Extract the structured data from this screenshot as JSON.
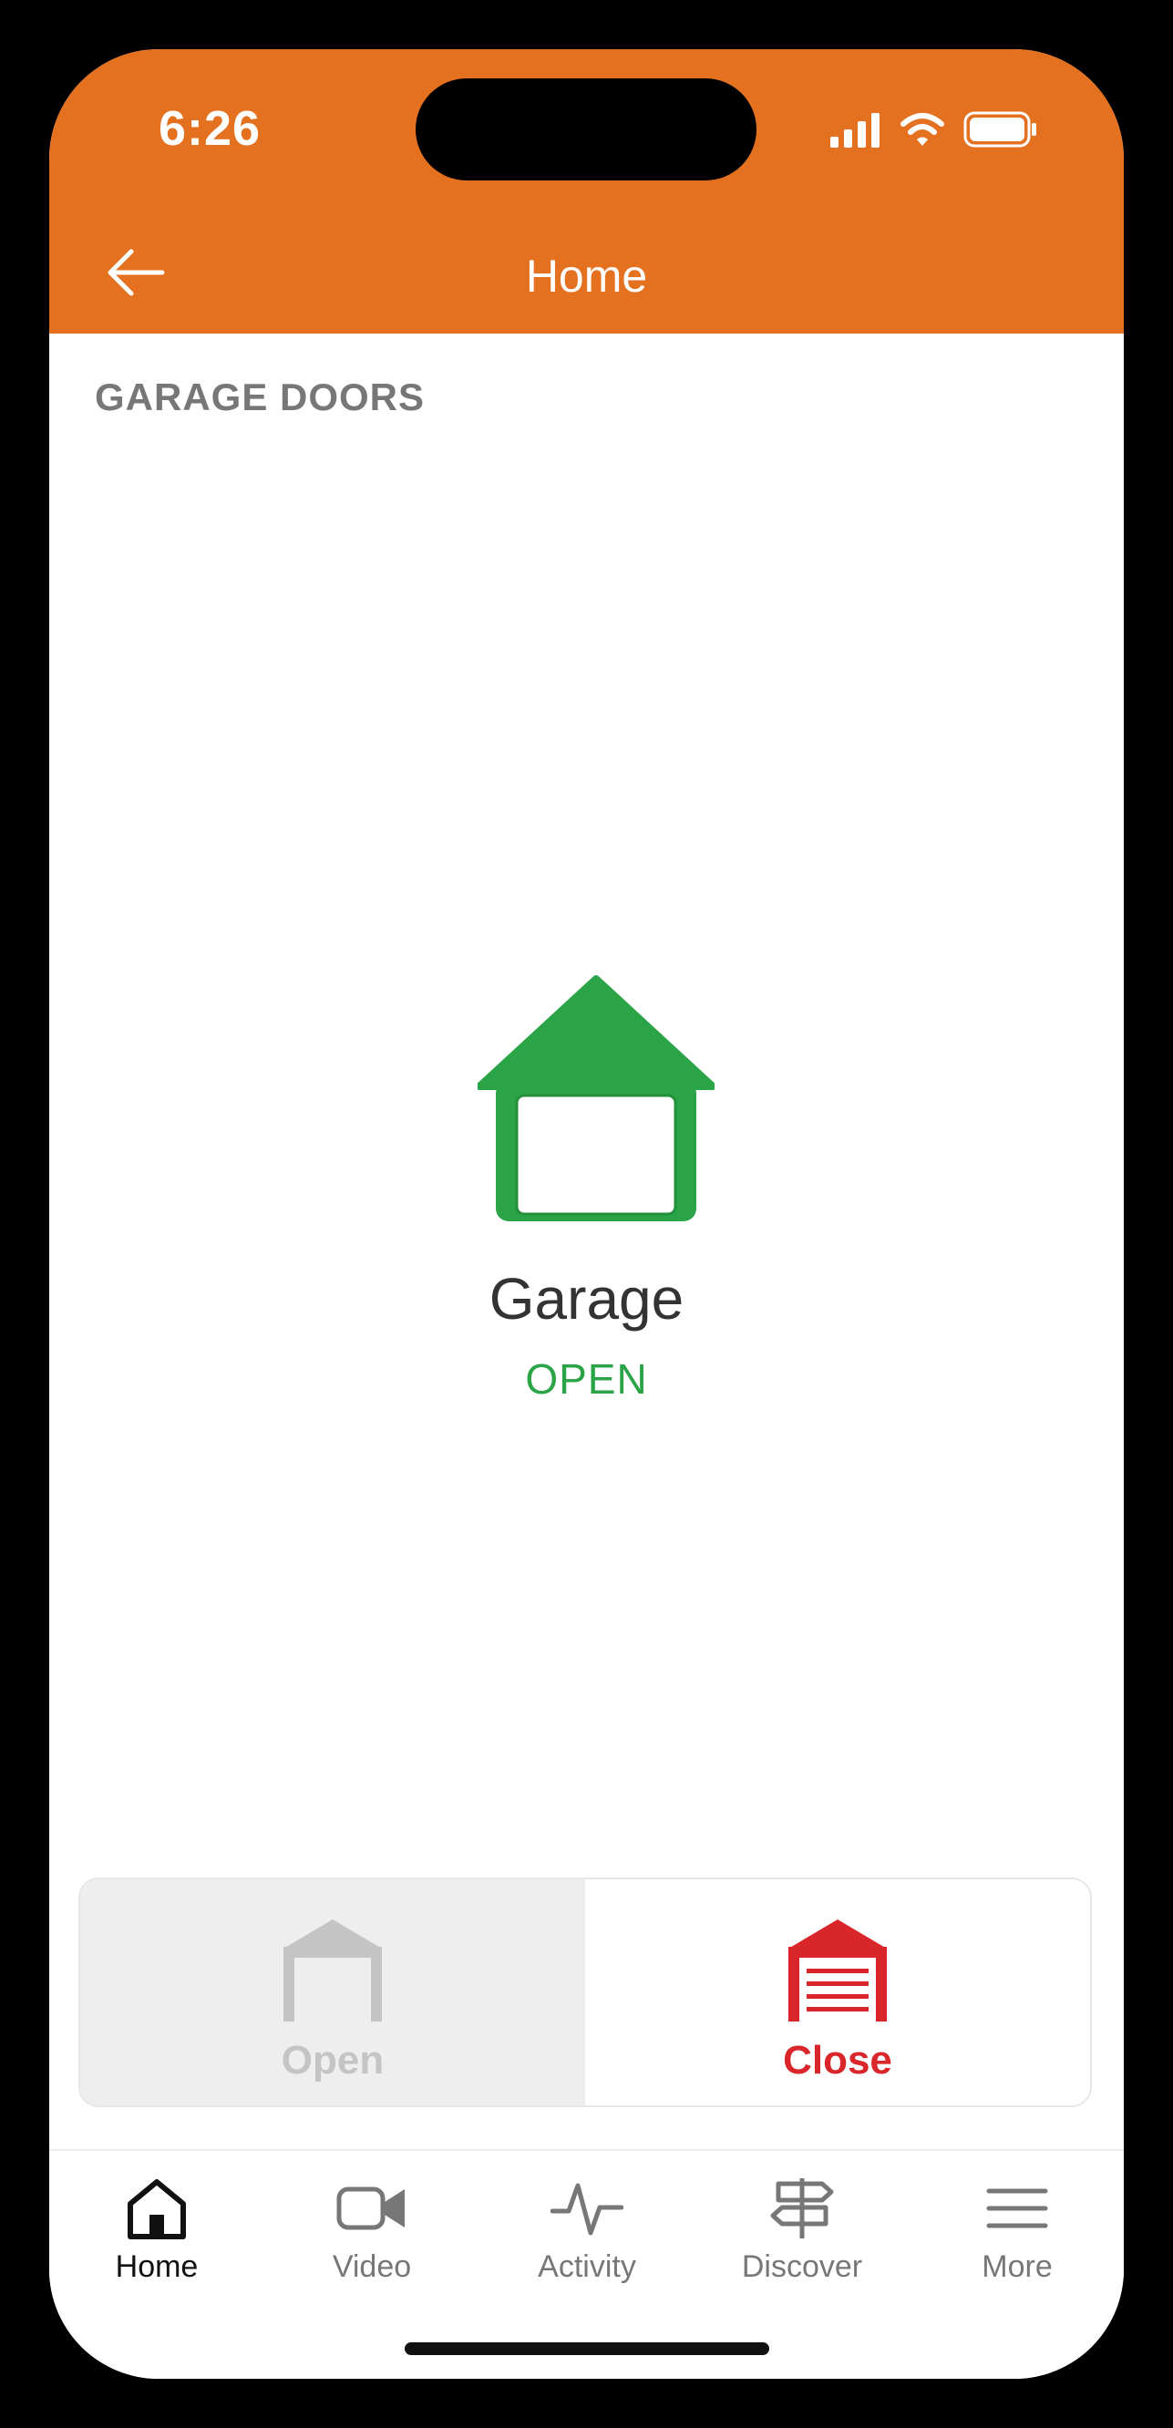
{
  "status_bar": {
    "time": "6:26"
  },
  "header": {
    "title": "Home",
    "back_icon": "arrow-left-icon",
    "background": "#E4711F"
  },
  "section": {
    "label": "GARAGE DOORS"
  },
  "garage": {
    "name": "Garage",
    "status": "OPEN",
    "status_color": "#2AA446",
    "icon": "garage-open-icon"
  },
  "actions": {
    "open": {
      "label": "Open",
      "icon": "garage-open-small-icon",
      "enabled": false
    },
    "close": {
      "label": "Close",
      "icon": "garage-closed-icon",
      "enabled": true,
      "color": "#D8262A"
    }
  },
  "tabs": [
    {
      "label": "Home",
      "icon": "home-icon",
      "active": true
    },
    {
      "label": "Video",
      "icon": "video-camera-icon",
      "active": false
    },
    {
      "label": "Activity",
      "icon": "activity-pulse-icon",
      "active": false
    },
    {
      "label": "Discover",
      "icon": "signpost-icon",
      "active": false
    },
    {
      "label": "More",
      "icon": "menu-icon",
      "active": false
    }
  ]
}
